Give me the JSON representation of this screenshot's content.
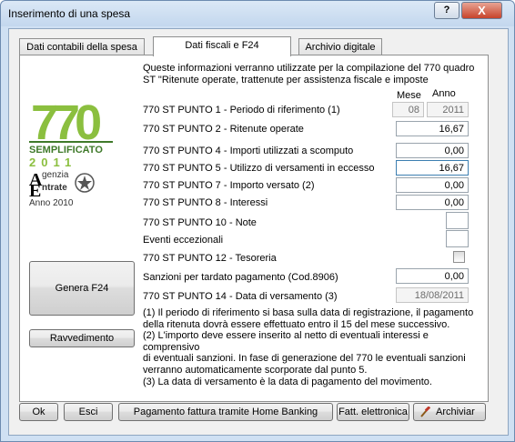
{
  "window": {
    "title": "Inserimento di una spesa",
    "help_label": "?",
    "close_label": "X"
  },
  "tabs": [
    {
      "label": "Dati contabili della spesa"
    },
    {
      "label": "Dati fiscali e F24"
    },
    {
      "label": "Archivio digitale"
    }
  ],
  "intro": {
    "line1": "Queste informazioni verranno utilizzate per la compilazione del 770 quadro",
    "line2": "ST \"Ritenute operate, trattenute per assistenza fiscale e imposte"
  },
  "logo": {
    "number": "770",
    "text1": "SEMPLIFICATO",
    "text2": "2011",
    "agenzia": "genzia",
    "entrate": "ntrate",
    "year_label": "Anno 2010"
  },
  "columns": {
    "mese": "Mese",
    "anno": "Anno"
  },
  "rows": {
    "punto1": {
      "label": "770 ST PUNTO 1 - Periodo di riferimento (1)",
      "mese": "08",
      "anno": "2011"
    },
    "punto2": {
      "label": "770 ST PUNTO 2 - Ritenute operate",
      "value": "16,67"
    },
    "punto4": {
      "label": "770 ST PUNTO 4 - Importi utilizzati a scomputo",
      "value": "0,00"
    },
    "punto5": {
      "label": "770 ST PUNTO 5 - Utilizzo di versamenti in eccesso",
      "value": "16,67"
    },
    "punto7": {
      "label": "770 ST PUNTO 7 - Importo versato (2)",
      "value": "0,00"
    },
    "punto8": {
      "label": "770 ST PUNTO 8 - Interessi",
      "value": "0,00"
    },
    "punto10": {
      "label": "770 ST PUNTO 10 - Note",
      "value": ""
    },
    "eventi": {
      "label": "Eventi eccezionali",
      "value": ""
    },
    "punto12": {
      "label": "770 ST PUNTO 12 - Tesoreria",
      "checked": false
    },
    "sanzioni": {
      "label": "Sanzioni per tardato pagamento (Cod.8906)",
      "value": "0,00"
    },
    "punto14": {
      "label": "770 ST PUNTO 14 - Data di versamento (3)",
      "value": "18/08/2011"
    }
  },
  "buttons": {
    "genera": "Genera F24",
    "ravvedimento": "Ravvedimento",
    "ok": "Ok",
    "esci": "Esci",
    "pagamento": "Pagamento fattura tramite Home Banking",
    "fatt": "Fatt. elettronica",
    "archivia": "Archiviar"
  },
  "notes": {
    "n1a": "(1) Il periodo di riferimento si basa sulla data di registrazione, il pagamento",
    "n1b": "della ritenuta dovrà essere effettuato entro il 15 del mese successivo.",
    "n2a": "(2) L'importo deve essere inserito al netto di eventuali interessi e comprensivo",
    "n2b": "di eventuali sanzioni. In fase di generazione del 770 le eventuali sanzioni",
    "n2c": "verranno automaticamente scorporate dal punto 5.",
    "n3": "(3) La data di versamento è la data di pagamento del movimento."
  },
  "colors": {
    "accent_green": "#8bbf3f",
    "dark_green": "#3f7a2a",
    "title_bg": "#c3d7ee"
  }
}
